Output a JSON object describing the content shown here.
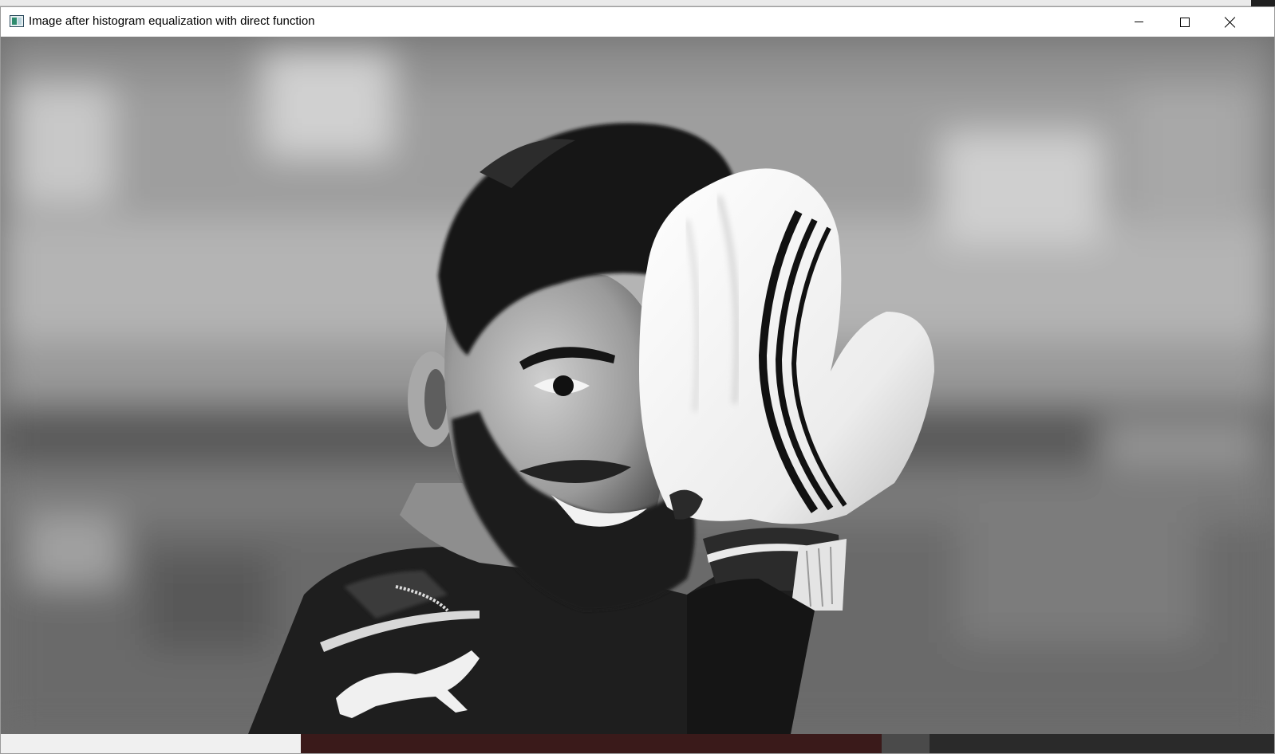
{
  "window": {
    "title": "Image after histogram equalization with direct function",
    "app_icon": "opencv-window-icon",
    "controls": {
      "minimize_icon": "minimize-icon",
      "maximize_icon": "maximize-icon",
      "close_icon": "close-icon"
    }
  },
  "image": {
    "description_icon": "grayscale-photo",
    "mode": "grayscale"
  }
}
